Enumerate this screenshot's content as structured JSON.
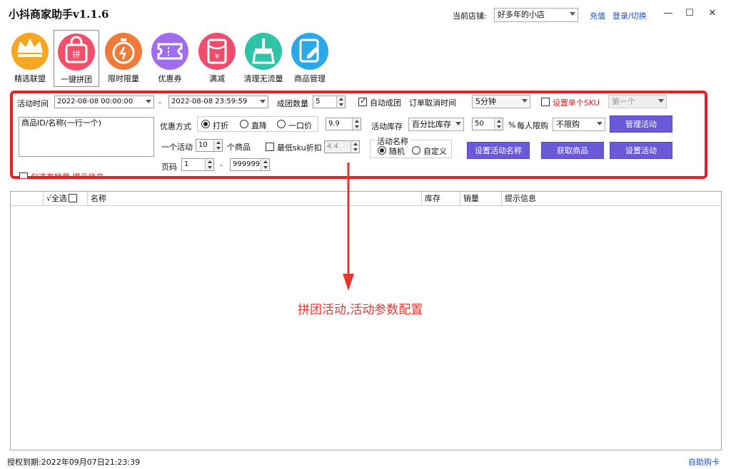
{
  "app": {
    "title": "小抖商家助手v1.1.6",
    "store_label": "当前店铺:",
    "store_value": "好多年的小店",
    "recharge": "充值",
    "login": "登录/切换"
  },
  "toolbar": [
    {
      "label": "精选联盟",
      "icon": "crown-icon",
      "color": "#f5a623"
    },
    {
      "label": "一键拼团",
      "icon": "shopping-bag-icon",
      "color": "#f2506a"
    },
    {
      "label": "限时限量",
      "icon": "stopwatch-icon",
      "color": "#f07a3a"
    },
    {
      "label": "优惠券",
      "icon": "ticket-icon",
      "color": "#a06cf0"
    },
    {
      "label": "满减",
      "icon": "red-envelope-icon",
      "color": "#f04d6e"
    },
    {
      "label": "清理无流量",
      "icon": "broom-icon",
      "color": "#2fc4a8"
    },
    {
      "label": "商品管理",
      "icon": "edit-icon",
      "color": "#2aa8e8"
    }
  ],
  "form": {
    "activity_time_label": "活动时间",
    "start_time": "2022-08-08 00:00:00",
    "dash": "-",
    "end_time": "2022-08-08 23:59:59",
    "group_count_label": "成团数量",
    "group_count": "5",
    "auto_group_label": "自动成团",
    "cancel_time_label": "订单取消时间",
    "cancel_time": "5分钟",
    "single_sku_label": "设置单个SKU",
    "single_sku_value": "第一个",
    "product_id_placeholder": "商品ID/名称(一行一个)",
    "discount_type_label": "优惠方式",
    "discount_opt1": "打折",
    "discount_opt2": "直降",
    "discount_opt3": "一口价",
    "discount_value": "9.9",
    "stock_label": "活动库存",
    "stock_value": "百分比库存",
    "stock_pct": "50",
    "pct_sign": "%",
    "limit_label": "每人限购",
    "limit_value": "不限购",
    "manage_button": "管理活动",
    "per_activity_label": "一个活动",
    "per_activity_value": "10",
    "per_activity_unit": "个商品",
    "min_sku_label": "最低sku折扣",
    "min_sku_value": "4.4",
    "name_label": "活动名称",
    "name_opt1": "随机",
    "name_opt2": "自定义",
    "set_name_button": "设置活动名称",
    "get_products_button": "获取商品",
    "set_activity_button": "设置活动",
    "page_label": "页码",
    "page_from": "1",
    "page_dash": "-",
    "page_to": "999999",
    "sales_checkbox_label": "勾选有销量 提示信息"
  },
  "table": {
    "headers": [
      "",
      "√全选",
      "名称",
      "库存",
      "销量",
      "提示信息"
    ]
  },
  "annotation": "拼团活动,活动参数配置",
  "footer": {
    "expiry": "授权到期:2022年09月07日21:23:39",
    "buy_card": "自助购卡"
  }
}
